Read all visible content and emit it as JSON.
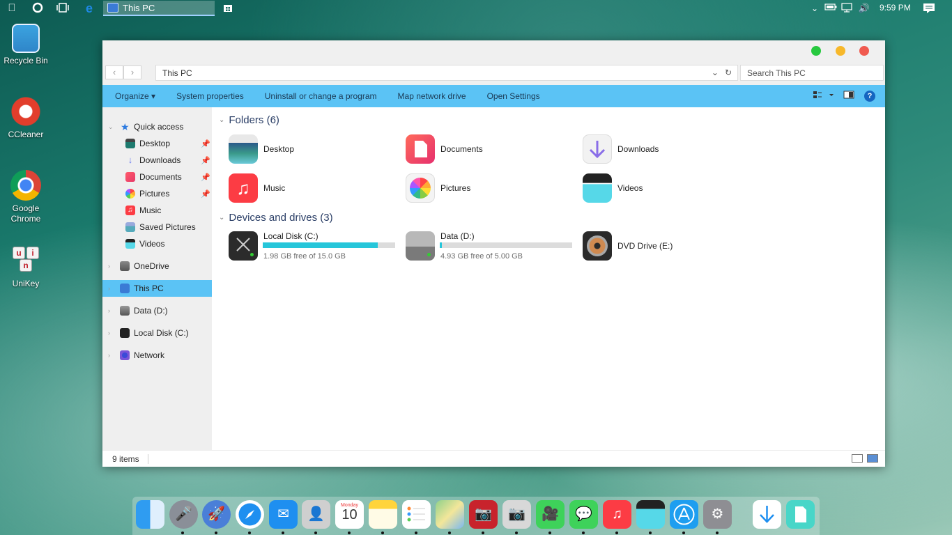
{
  "topbar": {
    "app_title": "This PC",
    "clock": "9:59 PM"
  },
  "desktop": [
    {
      "label": "Recycle Bin"
    },
    {
      "label": "CCleaner"
    },
    {
      "label": "Google Chrome"
    },
    {
      "label": "UniKey"
    }
  ],
  "unikey_keys": [
    "u",
    "i",
    "n"
  ],
  "window": {
    "address": "This PC",
    "search_placeholder": "Search This PC",
    "ribbon": {
      "organize": "Organize ▾",
      "system_properties": "System properties",
      "uninstall": "Uninstall or change a program",
      "map_drive": "Map network drive",
      "open_settings": "Open Settings"
    },
    "nav": {
      "quick_access": "Quick access",
      "qa_items": [
        "Desktop",
        "Downloads",
        "Documents",
        "Pictures",
        "Music",
        "Saved Pictures",
        "Videos"
      ],
      "onedrive": "OneDrive",
      "this_pc": "This PC",
      "data_d": "Data (D:)",
      "local_c": "Local Disk (C:)",
      "network": "Network"
    },
    "folders_header": "Folders (6)",
    "folders": [
      {
        "name": "Desktop"
      },
      {
        "name": "Documents"
      },
      {
        "name": "Downloads"
      },
      {
        "name": "Music"
      },
      {
        "name": "Pictures"
      },
      {
        "name": "Videos"
      }
    ],
    "devices_header": "Devices and drives (3)",
    "drives": [
      {
        "name": "Local Disk (C:)",
        "free": "1.98 GB free of 15.0 GB",
        "used_fraction": 0.868
      },
      {
        "name": "Data (D:)",
        "free": "4.93 GB free of 5.00 GB",
        "used_fraction": 0.014
      },
      {
        "name": "DVD Drive (E:)"
      }
    ],
    "status": "9 items"
  },
  "colors": {
    "ribbon": "#5bc3f5",
    "selection": "#5bc3f5",
    "drive_bar_fill": "#26c6da",
    "close": "#f05a4f",
    "minimize": "#f7b82a",
    "maximize": "#27c93f"
  },
  "dock": [
    "finder-icon",
    "siri-icon",
    "launchpad-icon",
    "safari-icon",
    "mail-icon",
    "contacts-icon",
    "calendar-icon",
    "notes-icon",
    "reminders-icon",
    "maps-icon",
    "photo-booth-icon",
    "camera-icon",
    "facetime-icon",
    "messages-icon",
    "music-icon",
    "clips-icon",
    "app-store-icon",
    "settings-icon",
    "downloads-icon",
    "files-icon"
  ],
  "calendar": {
    "weekday": "Monday",
    "day": "10"
  }
}
